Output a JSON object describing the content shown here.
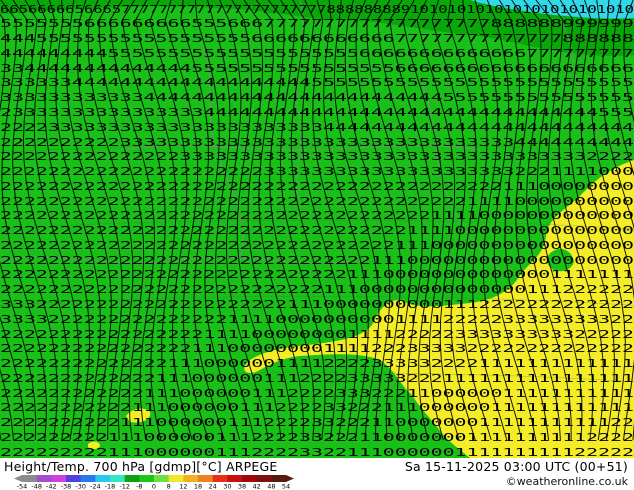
{
  "map": {
    "field_colors": {
      "main_green": "#18c018",
      "dark_green": "#08a808",
      "cold_cyan": "#30d8e8",
      "warm_yellow": "#f5ec28"
    },
    "contour_color": "#000000",
    "border_color": "#888888",
    "label_rows": [
      {
        "row": 0,
        "text": "6656666656665777777777777777777777788888888",
        "tail": "9101010101010101010101010"
      },
      {
        "row": 1,
        "text": "55555556666666665556667777777777777777777888888999999"
      },
      {
        "row": 2,
        "text": "44455555555555555555566666666666677777777777777888888"
      },
      {
        "row": 3,
        "text": "44444444455555555555555555555566666666666666777777777"
      },
      {
        "row": 4,
        "text": "33444444444444445555555555555555566666666666666666666"
      },
      {
        "row": 5,
        "text": "33333344444444444444444444555555555555555555555555555"
      },
      {
        "row": 6,
        "text": "33333333333344444444444444444444444445555555555555555"
      },
      {
        "row": 7,
        "text": "23333333333333333444444444444444444444444444444444555"
      },
      {
        "row": 8,
        "text": "22223333333333333333333333344444444444444444444444444"
      },
      {
        "row": 9,
        "text": "22222222223333333333333333333333333333333334444444444"
      },
      {
        "row": 10,
        "text": "22222222222222233333333333333333333333333333333332222"
      },
      {
        "row": 11,
        "text": "22222222222222222222223333333333333333333332221111000"
      },
      {
        "row": 12,
        "text": "22222222222222222222222222222222222222222211100000000"
      },
      {
        "row": 13,
        "text": "22222222222222222222222222222222222222211110000000000"
      },
      {
        "row": 14,
        "text": "22222222222222222222222222222222222211110000000000000"
      },
      {
        "row": 15,
        "text": "22222222222222222222222222222222221111000000000000000"
      },
      {
        "row": 16,
        "text": "22222222222222222222222222222222211100000000000000000"
      },
      {
        "row": 17,
        "text": "22222222222222222222222222222221110000000000000000000"
      },
      {
        "row": 18,
        "text": "22222222222222222222222222222111000000000000001111111"
      },
      {
        "row": 19,
        "text": "22222222222222222222222222211100000000000000111222222"
      },
      {
        "row": 20,
        "text": "33322222222222222222222211100000000001112222222222222"
      },
      {
        "row": 21,
        "text": "33332222222222222221111000000000011112222233333333322"
      },
      {
        "row": 22,
        "text": "22222222222222222111100000000111122222333333333322222"
      },
      {
        "row": 23,
        "text": "22222222222222221110000000011112223333322222222222222"
      },
      {
        "row": 24,
        "text": "22222222222222111000000111122223333322221111111111111"
      },
      {
        "row": 25,
        "text": "22222222222221110000001112222333332221111111111111111"
      },
      {
        "row": 26,
        "text": "22222222222211100000011122223332221100000011111111111"
      },
      {
        "row": 27,
        "text": "22222222222111000000111222233222111000000111111111111"
      },
      {
        "row": 28,
        "text": "22222222221110000001112222332221100000001111111111122"
      },
      {
        "row": 29,
        "text": "22222222211100000011122223322211000000011111111112222"
      },
      {
        "row": 30,
        "text": "22222222211100000011122223322111000000111111111122222"
      }
    ]
  },
  "footer": {
    "title": "Height/Temp. 700 hPa [gdmp][°C] ARPEGE",
    "datetime": "Sa 15-11-2025 03:00 UTC (00+51)",
    "credit": "©weatheronline.co.uk"
  },
  "legend": {
    "ticks": [
      "-54",
      "-48",
      "-42",
      "-38",
      "-30",
      "-24",
      "-18",
      "-12",
      "-8",
      "0",
      "8",
      "12",
      "18",
      "24",
      "30",
      "38",
      "42",
      "48",
      "54"
    ],
    "colors": [
      "#8c8c8c",
      "#a050c8",
      "#d040e0",
      "#5040e0",
      "#2878f0",
      "#28c8f0",
      "#30e8c8",
      "#10a010",
      "#18c818",
      "#70e040",
      "#f0e828",
      "#f0b020",
      "#f08020",
      "#e83018",
      "#c81010",
      "#a00808",
      "#801010",
      "#5a1a10"
    ]
  }
}
